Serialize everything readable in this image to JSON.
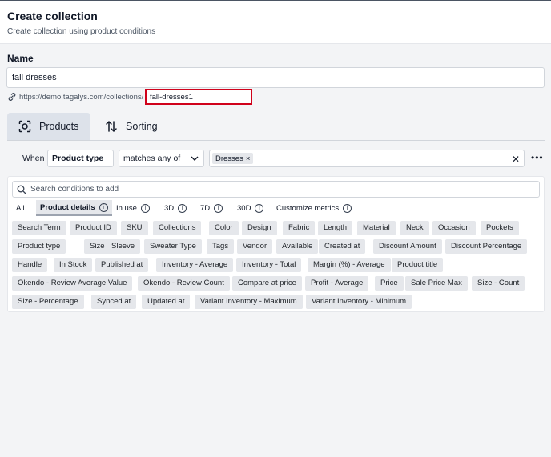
{
  "header": {
    "title": "Create collection",
    "subtitle": "Create collection using product conditions"
  },
  "name_section": {
    "label": "Name",
    "value": "fall dresses",
    "url_base": "https://demo.tagalys.com/collections/",
    "slug": "fall-dresses1"
  },
  "tabs": [
    {
      "label": "Products",
      "icon": "products-icon",
      "active": true
    },
    {
      "label": "Sorting",
      "icon": "sort-icon",
      "active": false
    }
  ],
  "condition": {
    "when_label": "When",
    "field": "Product type",
    "operator": "matches any of",
    "values": [
      "Dresses"
    ]
  },
  "picker": {
    "search_placeholder": "Search conditions to add",
    "filter_tabs": [
      {
        "label": "All",
        "active": false,
        "info": false
      },
      {
        "label": "Product details",
        "active": true,
        "info": true
      },
      {
        "label": "In use",
        "active": false,
        "info": true
      },
      {
        "label": "3D",
        "active": false,
        "info": true
      },
      {
        "label": "7D",
        "active": false,
        "info": true
      },
      {
        "label": "30D",
        "active": false,
        "info": true
      },
      {
        "label": "Customize metrics",
        "active": false,
        "info": true
      }
    ],
    "conditions": [
      [
        "Search Term",
        "Product ID",
        "SKU",
        "Collections",
        "Color",
        "Design",
        "Fabric",
        "Length",
        "Material",
        "Neck",
        "Occasion",
        "Pockets"
      ],
      [
        "Product type",
        "Size",
        "Sleeve",
        "Sweater Type",
        "Tags",
        "Vendor",
        "Available",
        "Created at",
        "Discount Amount",
        "Discount Percentage"
      ],
      [
        "Handle",
        "In Stock",
        "Published at",
        "Inventory - Average",
        "Inventory - Total",
        "Margin (%) - Average",
        "Product title"
      ],
      [
        "Okendo - Review Average Value",
        "Okendo - Review Count",
        "Compare at price",
        "Profit - Average",
        "Price",
        "Sale Price Max",
        "Size - Count"
      ],
      [
        "Size - Percentage",
        "Synced at",
        "Updated at",
        "Variant Inventory - Maximum",
        "Variant Inventory - Minimum"
      ]
    ]
  },
  "colors": {
    "highlight_border": "#d0021b",
    "chip_bg": "#e5e7eb",
    "active_tab_bg": "#dde2ea"
  }
}
